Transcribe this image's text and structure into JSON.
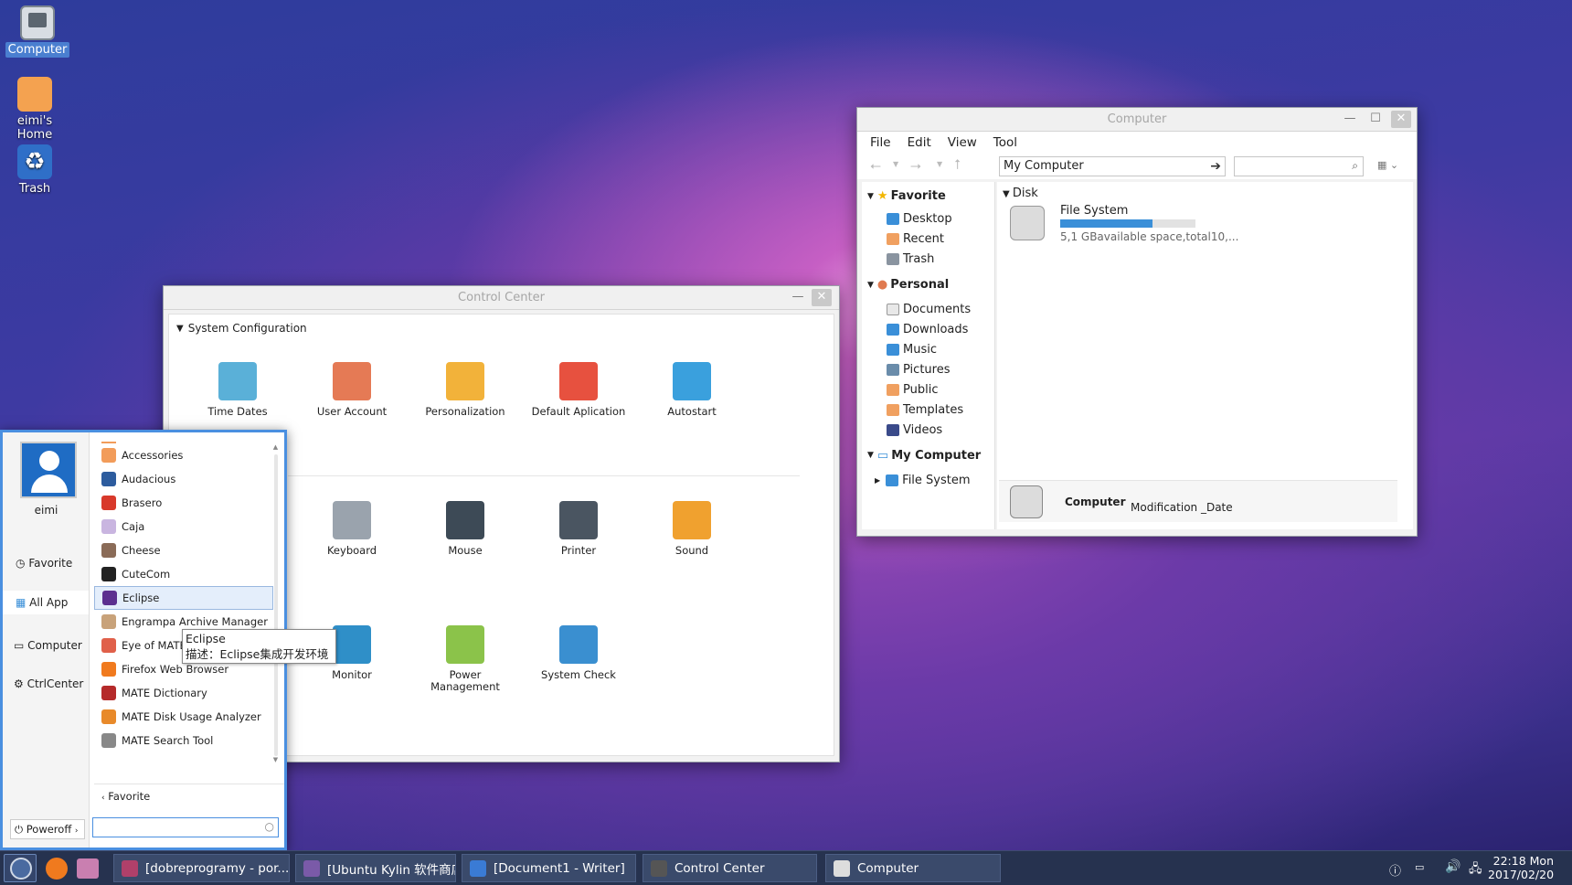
{
  "desktop": {
    "icons": [
      {
        "label": "Computer"
      },
      {
        "label": "eimi's Home"
      },
      {
        "label": "Trash"
      }
    ]
  },
  "control_center": {
    "title": "Control Center",
    "section": "System Configuration",
    "items": [
      {
        "label": "Time Dates",
        "icon": "clock-icon",
        "color": "#5ab0d8"
      },
      {
        "label": "User Account",
        "icon": "users-icon",
        "color": "#e57a55"
      },
      {
        "label": "Personalization",
        "icon": "palette-icon",
        "color": "#f2b23a"
      },
      {
        "label": "Default Aplication",
        "icon": "default-app-icon",
        "color": "#e7513f"
      },
      {
        "label": "Autostart",
        "icon": "power-icon",
        "color": "#3aa0dd"
      },
      {
        "label": "Keyboard",
        "icon": "keyboard-icon",
        "color": "#9aa3ad"
      },
      {
        "label": "Mouse",
        "icon": "mouse-icon",
        "color": "#3d4a56"
      },
      {
        "label": "Printer",
        "icon": "printer-icon",
        "color": "#4a5561"
      },
      {
        "label": "Sound",
        "icon": "speaker-icon",
        "color": "#f0a12f"
      },
      {
        "label": "Monitor",
        "icon": "monitor-icon",
        "color": "#2f8fc8"
      },
      {
        "label": "Power Management",
        "icon": "battery-icon",
        "color": "#8bc34a"
      },
      {
        "label": "System Check",
        "icon": "system-check-icon",
        "color": "#3a8fd0"
      }
    ]
  },
  "file_manager": {
    "title": "Computer",
    "menu": [
      "File",
      "Edit",
      "View",
      "Tool"
    ],
    "address": "My Computer",
    "sidebar": {
      "favorite": {
        "label": "Favorite",
        "items": [
          "Desktop",
          "Recent",
          "Trash"
        ]
      },
      "personal": {
        "label": "Personal",
        "items": [
          "Documents",
          "Downloads",
          "Music",
          "Pictures",
          "Public",
          "Templates",
          "Videos"
        ]
      },
      "computer": {
        "label": "My Computer",
        "items": [
          "File System"
        ]
      }
    },
    "disk_section": "Disk",
    "disk": {
      "name": "File System",
      "info": "5,1 GBavailable space,total10,...",
      "used_fraction": 0.68
    },
    "status": {
      "name": "Computer",
      "detail": "Modification _Date"
    }
  },
  "start_menu": {
    "user": "eimi",
    "nav": [
      "Favorite",
      "All App",
      "Computer",
      "CtrlCenter"
    ],
    "apps": [
      {
        "label": "Accessories",
        "color": "#f29c5a"
      },
      {
        "label": "Audacious",
        "color": "#2d5c9e"
      },
      {
        "label": "Brasero",
        "color": "#d8392b"
      },
      {
        "label": "Caja",
        "color": "#c9b5e0"
      },
      {
        "label": "Cheese",
        "color": "#8a6b57"
      },
      {
        "label": "CuteCom",
        "color": "#222"
      },
      {
        "label": "Eclipse",
        "color": "#5c2f8f"
      },
      {
        "label": "Engrampa Archive Manager",
        "color": "#c8a27a"
      },
      {
        "label": "Eye of MATE Image Viewer",
        "color": "#e0604a"
      },
      {
        "label": "Firefox Web Browser",
        "color": "#f07a1e"
      },
      {
        "label": "MATE Dictionary",
        "color": "#b52a2a"
      },
      {
        "label": "MATE Disk Usage Analyzer",
        "color": "#e88a2a"
      },
      {
        "label": "MATE Search Tool",
        "color": "#888"
      }
    ],
    "back": "Favorite",
    "poweroff": "Poweroff"
  },
  "tooltip": {
    "title": "Eclipse",
    "desc": "描述：Eclipse集成开发环境"
  },
  "taskbar": {
    "tasks": [
      {
        "label": "[dobreprogramy - por...",
        "color": "#b0406a"
      },
      {
        "label": "[Ubuntu Kylin 软件商店]",
        "color": "#7a5aa8"
      },
      {
        "label": "[Document1 - Writer]",
        "color": "#3a7bd5"
      },
      {
        "label": "Control Center",
        "color": "#555"
      },
      {
        "label": "Computer",
        "color": "#ddd"
      }
    ],
    "time": "22:18 Mon",
    "date": "2017/02/20"
  }
}
